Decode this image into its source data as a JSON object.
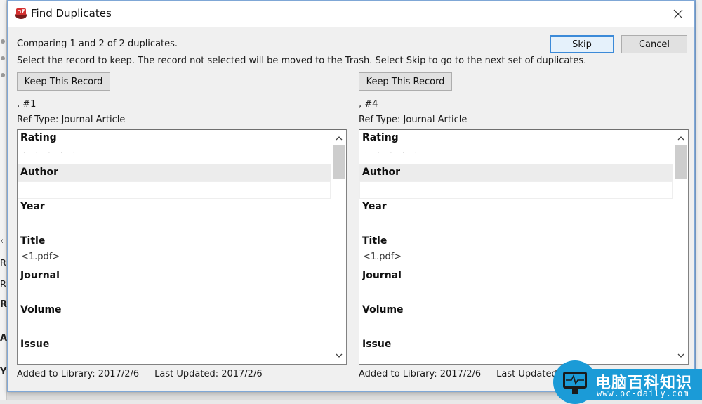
{
  "window": {
    "title": "Find Duplicates",
    "app_icon": "endnote-app-icon",
    "close_icon": "close-icon"
  },
  "messages": {
    "comparing": "Comparing 1 and 2 of 2 duplicates.",
    "instruction": "Select the record to keep. The record not selected will be moved to the Trash. Select Skip to go to the next set of duplicates."
  },
  "buttons": {
    "skip": "Skip",
    "cancel": "Cancel"
  },
  "records": [
    {
      "keep_label": "Keep This Record",
      "ref_number": ",  #1",
      "ref_type": "Ref Type: Journal Article",
      "fields": [
        {
          "label": "Rating",
          "value": "· · · · ·",
          "rating_stars": 0
        },
        {
          "label": "Author",
          "value": ""
        },
        {
          "label": "Year",
          "value": ""
        },
        {
          "label": "Title",
          "value": "<1.pdf>"
        },
        {
          "label": "Journal",
          "value": ""
        },
        {
          "label": "Volume",
          "value": ""
        },
        {
          "label": "Issue",
          "value": ""
        }
      ],
      "added": "Added to Library: 2017/2/6",
      "updated": "Last Updated: 2017/2/6"
    },
    {
      "keep_label": "Keep This Record",
      "ref_number": ",  #4",
      "ref_type": "Ref Type: Journal Article",
      "fields": [
        {
          "label": "Rating",
          "value": "· · · · ·",
          "rating_stars": 0
        },
        {
          "label": "Author",
          "value": ""
        },
        {
          "label": "Year",
          "value": ""
        },
        {
          "label": "Title",
          "value": "<1.pdf>"
        },
        {
          "label": "Journal",
          "value": ""
        },
        {
          "label": "Volume",
          "value": ""
        },
        {
          "label": "Issue",
          "value": ""
        }
      ],
      "added": "Added to Library: 2017/2/6",
      "updated": "Last Updated: 2017/2/6"
    }
  ],
  "scrollbar": {
    "up_glyph": "^",
    "down_glyph": "v"
  },
  "background": {
    "left_letters": [
      "R",
      "R",
      "R",
      "A",
      "Y"
    ]
  },
  "watermark": {
    "text_cn": "电脑百科知识",
    "url": "www.pc-daily.com"
  },
  "colors": {
    "accent": "#3c8ad8",
    "dialog_bg": "#f0f0f0",
    "watermark": "#1b9bd7"
  }
}
